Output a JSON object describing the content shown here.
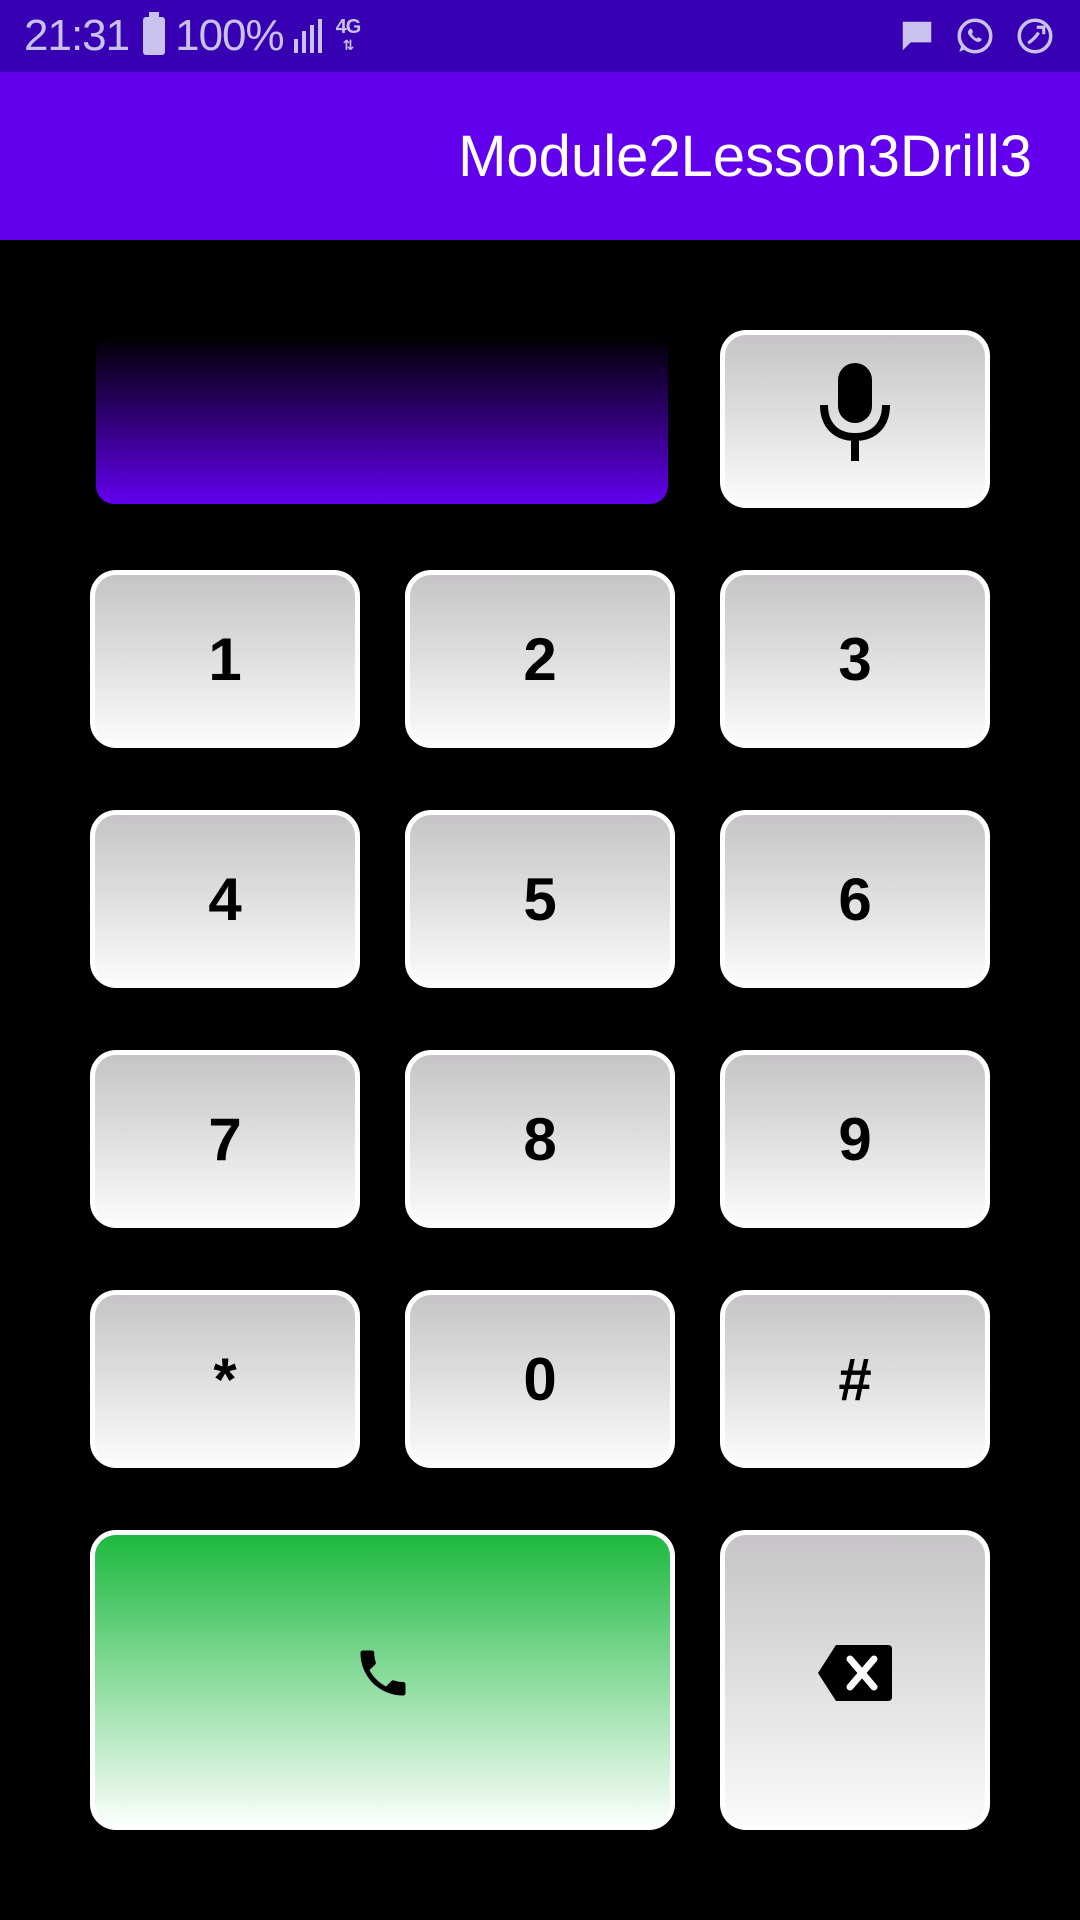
{
  "status_bar": {
    "time": "21:31",
    "battery": "100%",
    "network": "4G",
    "icons": [
      "battery-icon",
      "signal-icon",
      "message-icon",
      "whatsapp-icon",
      "call-forward-icon"
    ]
  },
  "app_bar": {
    "title": "Module2Lesson3Drill3"
  },
  "dialer": {
    "display_value": "",
    "keys": [
      "1",
      "2",
      "3",
      "4",
      "5",
      "6",
      "7",
      "8",
      "9",
      "*",
      "0",
      "#"
    ],
    "icons": {
      "mic": "microphone-icon",
      "call": "phone-icon",
      "backspace": "backspace-icon"
    }
  },
  "colors": {
    "status_bar": "#3700b3",
    "app_bar": "#6200ee",
    "background": "#000000",
    "call_green": "#1db83f"
  }
}
